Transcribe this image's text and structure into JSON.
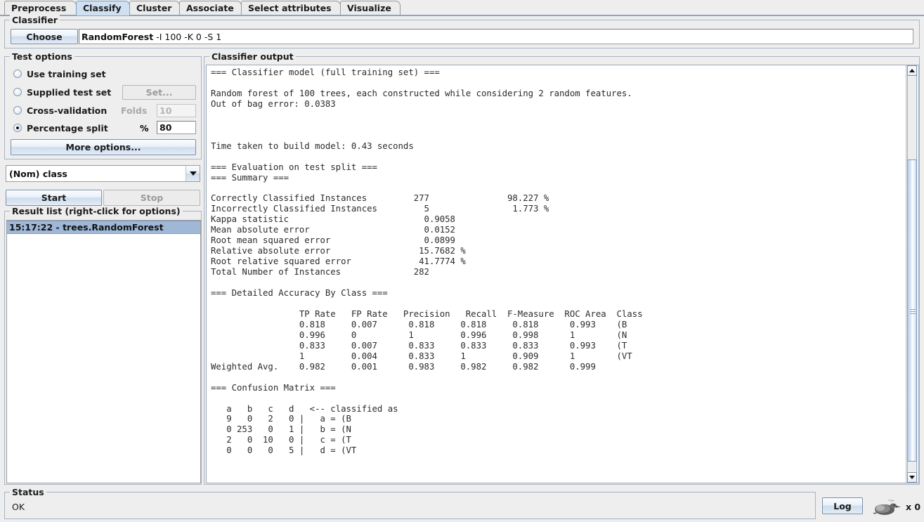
{
  "window": {
    "tabs": [
      {
        "label": "Preprocess",
        "selected": false
      },
      {
        "label": "Classify",
        "selected": true
      },
      {
        "label": "Cluster",
        "selected": false
      },
      {
        "label": "Associate",
        "selected": false
      },
      {
        "label": "Select attributes",
        "selected": false
      },
      {
        "label": "Visualize",
        "selected": false
      }
    ]
  },
  "classifier": {
    "group_title": "Classifier",
    "choose_label": "Choose",
    "selected_name": "RandomForest",
    "selected_options": "-I 100 -K 0 -S 1",
    "selected_full": "RandomForest -I 100 -K 0 -S 1"
  },
  "test_options": {
    "group_title": "Test options",
    "radios": [
      {
        "label": "Use training set",
        "checked": false
      },
      {
        "label": "Supplied test set",
        "checked": false
      },
      {
        "label": "Cross-validation",
        "checked": false
      },
      {
        "label": "Percentage split",
        "checked": true
      }
    ],
    "set_button": "Set...",
    "folds_label": "Folds",
    "folds_value": "10",
    "percent_label": "%",
    "percent_value": "80",
    "more_options_button": "More options..."
  },
  "class_selector": {
    "value": "(Nom) class"
  },
  "run_buttons": {
    "start": "Start",
    "stop": "Stop"
  },
  "result_list": {
    "group_title": "Result list (right-click for options)",
    "items": [
      {
        "label": "15:17:22 - trees.RandomForest",
        "selected": true
      }
    ]
  },
  "output": {
    "group_title": "Classifier output",
    "text": "=== Classifier model (full training set) ===\n\nRandom forest of 100 trees, each constructed while considering 2 random features.\nOut of bag error: 0.0383\n\n\n\nTime taken to build model: 0.43 seconds\n\n=== Evaluation on test split ===\n=== Summary ===\n\nCorrectly Classified Instances         277               98.227 %\nIncorrectly Classified Instances         5                1.773 %\nKappa statistic                          0.9058\nMean absolute error                      0.0152\nRoot mean squared error                  0.0899\nRelative absolute error                 15.7682 %\nRoot relative squared error             41.7774 %\nTotal Number of Instances              282     \n\n=== Detailed Accuracy By Class ===\n\n                 TP Rate   FP Rate   Precision   Recall  F-Measure  ROC Area  Class\n                 0.818     0.007      0.818     0.818     0.818      0.993    (B\n                 0.996     0          1         0.996     0.998      1        (N\n                 0.833     0.007      0.833     0.833     0.833      0.993    (T\n                 1         0.004      0.833     1         0.909      1        (VT\nWeighted Avg.    0.982     0.001      0.983     0.982     0.982      0.999\n\n=== Confusion Matrix ===\n\n   a   b   c   d   <-- classified as\n   9   0   2   0 |   a = (B\n   0 253   0   1 |   b = (N\n   2   0  10   0 |   c = (T\n   0   0   0   5 |   d = (VT"
  },
  "output_model": {
    "model_header": "=== Classifier model (full training set) ===",
    "forest_description": "Random forest of 100 trees, each constructed while considering 2 random features.",
    "oob_error_label": "Out of bag error",
    "oob_error_value": "0.0383",
    "build_time_label": "Time taken to build model",
    "build_time_value": "0.43 seconds",
    "evaluation_header": "=== Evaluation on test split ===",
    "summary_header": "=== Summary ===",
    "summary": [
      {
        "label": "Correctly Classified Instances",
        "count": "277",
        "percent": "98.227 %"
      },
      {
        "label": "Incorrectly Classified Instances",
        "count": "5",
        "percent": "1.773 %"
      },
      {
        "label": "Kappa statistic",
        "count": "0.9058",
        "percent": ""
      },
      {
        "label": "Mean absolute error",
        "count": "0.0152",
        "percent": ""
      },
      {
        "label": "Root mean squared error",
        "count": "0.0899",
        "percent": ""
      },
      {
        "label": "Relative absolute error",
        "count": "15.7682 %",
        "percent": ""
      },
      {
        "label": "Root relative squared error",
        "count": "41.7774 %",
        "percent": ""
      },
      {
        "label": "Total Number of Instances",
        "count": "282",
        "percent": ""
      }
    ],
    "accuracy_header": "=== Detailed Accuracy By Class ===",
    "accuracy_columns": [
      "TP Rate",
      "FP Rate",
      "Precision",
      "Recall",
      "F-Measure",
      "ROC Area",
      "Class"
    ],
    "accuracy_rows": [
      {
        "row_label": "",
        "tp_rate": "0.818",
        "fp_rate": "0.007",
        "precision": "0.818",
        "recall": "0.818",
        "f_measure": "0.818",
        "roc_area": "0.993",
        "class": "(B"
      },
      {
        "row_label": "",
        "tp_rate": "0.996",
        "fp_rate": "0",
        "precision": "1",
        "recall": "0.996",
        "f_measure": "0.998",
        "roc_area": "1",
        "class": "(N"
      },
      {
        "row_label": "",
        "tp_rate": "0.833",
        "fp_rate": "0.007",
        "precision": "0.833",
        "recall": "0.833",
        "f_measure": "0.833",
        "roc_area": "0.993",
        "class": "(T"
      },
      {
        "row_label": "",
        "tp_rate": "1",
        "fp_rate": "0.004",
        "precision": "0.833",
        "recall": "1",
        "f_measure": "0.909",
        "roc_area": "1",
        "class": "(VT"
      },
      {
        "row_label": "Weighted Avg.",
        "tp_rate": "0.982",
        "fp_rate": "0.001",
        "precision": "0.983",
        "recall": "0.982",
        "f_measure": "0.982",
        "roc_area": "0.999",
        "class": ""
      }
    ],
    "confusion_header": "=== Confusion Matrix ===",
    "confusion_columns": [
      "a",
      "b",
      "c",
      "d"
    ],
    "confusion_note": "<-- classified as",
    "confusion_rows": [
      {
        "values": [
          "9",
          "0",
          "2",
          "0"
        ],
        "key": "a = (B"
      },
      {
        "values": [
          "0",
          "253",
          "0",
          "1"
        ],
        "key": "b = (N"
      },
      {
        "values": [
          "2",
          "0",
          "10",
          "0"
        ],
        "key": "c = (T"
      },
      {
        "values": [
          "0",
          "0",
          "0",
          "5"
        ],
        "key": "d = (VT"
      }
    ]
  },
  "status": {
    "group_title": "Status",
    "message": "OK",
    "log_button": "Log",
    "running_count": "x 0"
  }
}
